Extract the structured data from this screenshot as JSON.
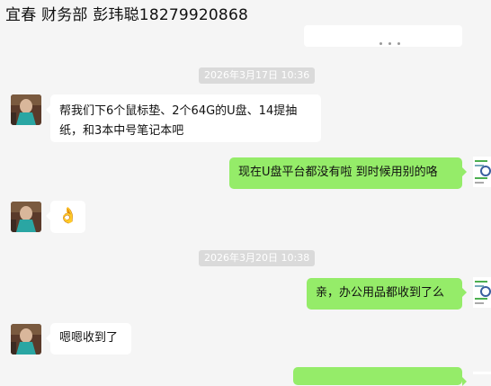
{
  "chat": {
    "title": "宜春 财务部 彭玮聪18279920868"
  },
  "messages": {
    "time1": "2026年3月17日 10:36",
    "msg1": "帮我们下6个鼠标垫、2个64G的U盘、14提抽纸，和3本中号笔记本吧",
    "msg2": "现在U盘平台都没有啦 到时候用别的咯",
    "msg3_emoji": "👌",
    "time2": "2026年3月20日 10:38",
    "msg4": "亲，办公用品都收到了么",
    "msg5": "嗯嗯收到了"
  },
  "colors": {
    "background": "#f5f5f5",
    "bubble_self": "#95ec69",
    "bubble_other": "#ffffff",
    "time_badge": "#dadada"
  }
}
